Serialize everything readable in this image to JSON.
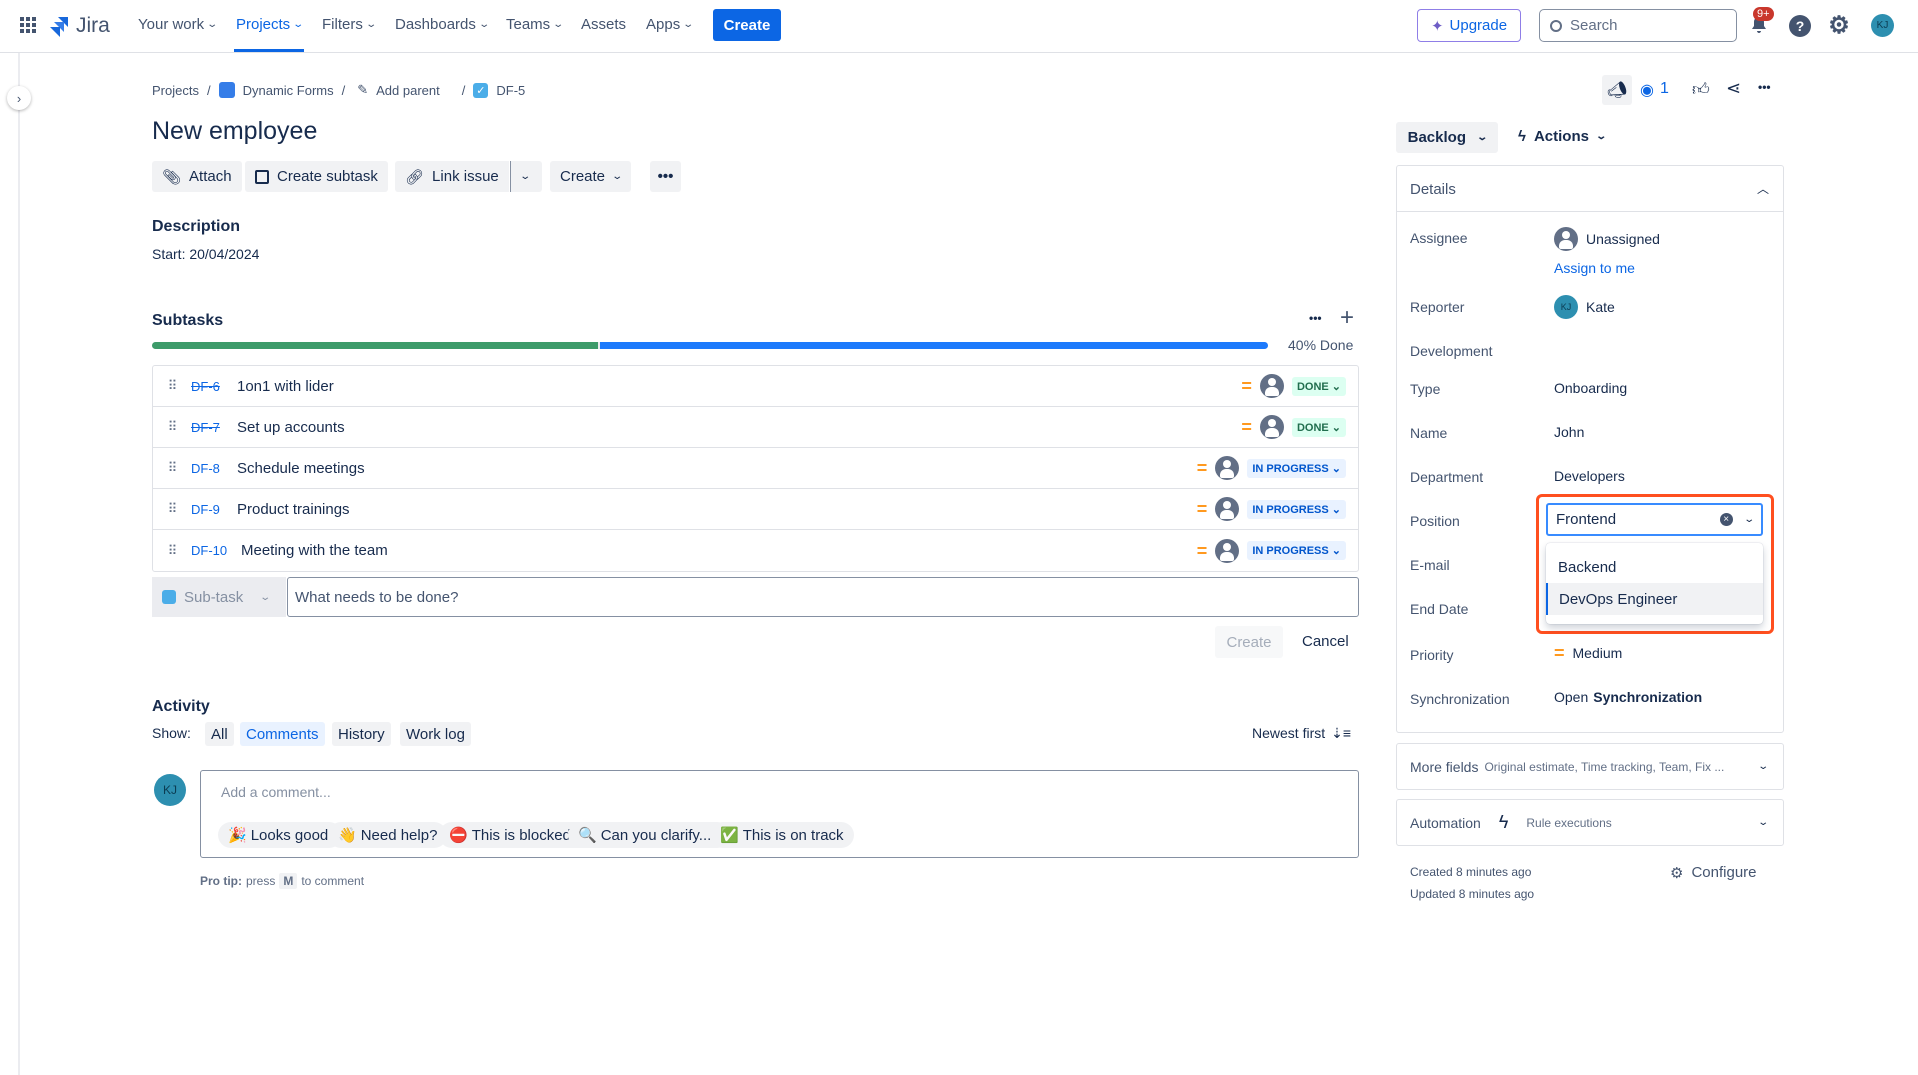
{
  "topnav": {
    "brand": "Jira",
    "items": [
      "Your work",
      "Projects",
      "Filters",
      "Dashboards",
      "Teams",
      "Assets",
      "Apps"
    ],
    "create": "Create",
    "upgrade": "Upgrade",
    "search_placeholder": "Search",
    "notifications": "9+",
    "user_initials": "KJ"
  },
  "breadcrumb": {
    "projects": "Projects",
    "project": "Dynamic Forms",
    "add_parent": "Add parent",
    "issue_key": "DF-5"
  },
  "issue": {
    "title": "New employee",
    "watchers": "1"
  },
  "toolbar": {
    "attach": "Attach",
    "create_subtask": "Create subtask",
    "link_issue": "Link issue",
    "create": "Create"
  },
  "description": {
    "heading": "Description",
    "text": "Start: 20/04/2024"
  },
  "subtasks": {
    "heading": "Subtasks",
    "progress_percent": 40,
    "progress_label": "40% Done",
    "items": [
      {
        "key": "DF-6",
        "title": "1on1 with lider",
        "status": "DONE",
        "done": true
      },
      {
        "key": "DF-7",
        "title": "Set up accounts",
        "status": "DONE",
        "done": true
      },
      {
        "key": "DF-8",
        "title": "Schedule meetings",
        "status": "IN PROGRESS",
        "done": false
      },
      {
        "key": "DF-9",
        "title": "Product trainings",
        "status": "IN PROGRESS",
        "done": false
      },
      {
        "key": "DF-10",
        "title": "Meeting with the team",
        "status": "IN PROGRESS",
        "done": false
      }
    ],
    "type_select": "Sub-task",
    "input_placeholder": "What needs to be done?",
    "create": "Create",
    "cancel": "Cancel"
  },
  "activity": {
    "heading": "Activity",
    "show": "Show:",
    "filters": [
      "All",
      "Comments",
      "History",
      "Work log"
    ],
    "active": "Comments",
    "sort": "Newest first",
    "comment_placeholder": "Add a comment...",
    "quick": [
      {
        "emoji": "🎉",
        "text": "Looks good!"
      },
      {
        "emoji": "👋",
        "text": "Need help?"
      },
      {
        "emoji": "⛔",
        "text": "This is blocked..."
      },
      {
        "emoji": "🔍",
        "text": "Can you clarify...?"
      },
      {
        "emoji": "✅",
        "text": "This is on track"
      }
    ],
    "protip_label": "Pro tip:",
    "protip_press": "press",
    "protip_key": "M",
    "protip_end": "to comment"
  },
  "sidebar": {
    "status": "Backlog",
    "actions": "Actions",
    "details": "Details",
    "fields": {
      "assignee_label": "Assignee",
      "assignee": "Unassigned",
      "assign_to_me": "Assign to me",
      "reporter_label": "Reporter",
      "reporter": "Kate",
      "reporter_initials": "KJ",
      "development_label": "Development",
      "type_label": "Type",
      "type": "Onboarding",
      "name_label": "Name",
      "name": "John",
      "department_label": "Department",
      "department": "Developers",
      "position_label": "Position",
      "position": "Frontend",
      "position_options": [
        "Backend",
        "DevOps Engineer"
      ],
      "email_label": "E-mail",
      "end_date_label": "End Date",
      "priority_label": "Priority",
      "priority": "Medium",
      "sync_label": "Synchronization",
      "sync_prefix": "Open",
      "sync_bold": "Synchronization"
    },
    "more_fields": "More fields",
    "more_fields_desc": "Original estimate, Time tracking, Team, Fix ...",
    "automation": "Automation",
    "rule_executions": "Rule executions",
    "created": "Created 8 minutes ago",
    "updated": "Updated 8 minutes ago",
    "configure": "Configure"
  },
  "colors": {
    "primary": "#0c66e4",
    "done": "#3d9b6a",
    "highlight": "#ff4f1f"
  }
}
